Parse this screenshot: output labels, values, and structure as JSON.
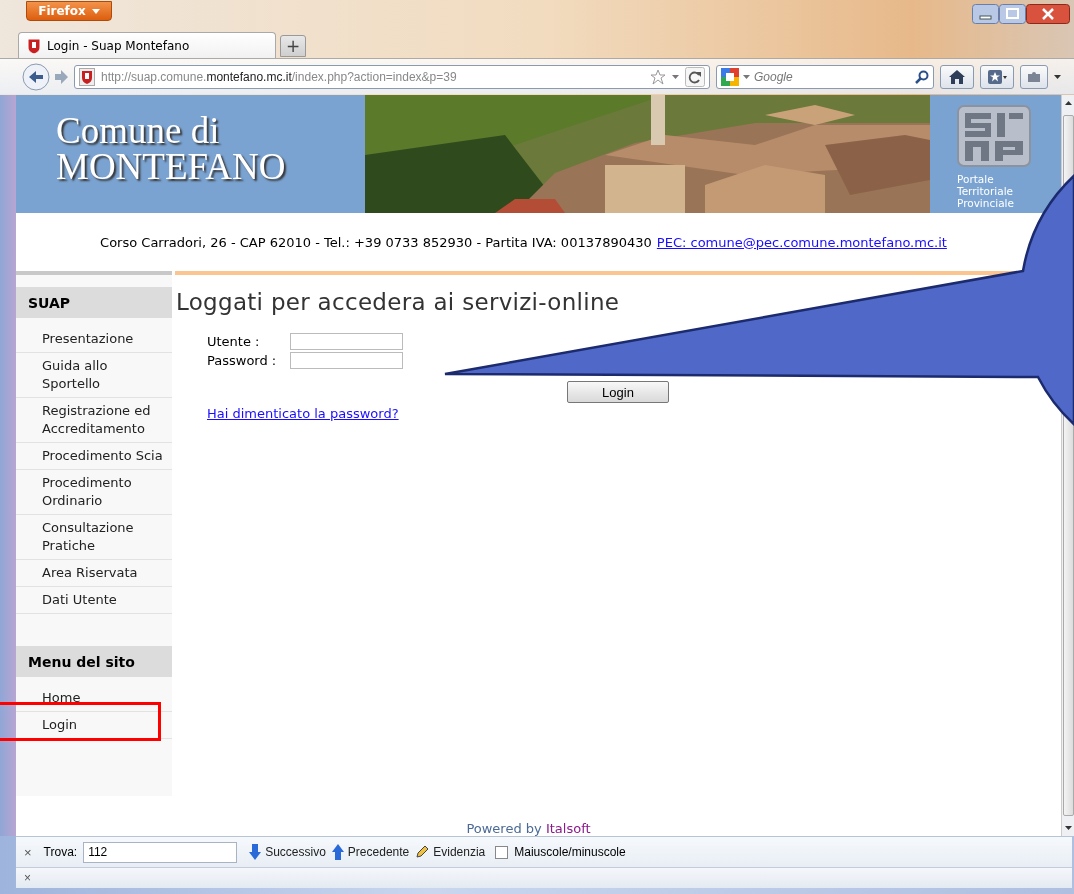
{
  "browser": {
    "menu_button": "Firefox",
    "tab": {
      "title": "Login - Suap Montefano"
    },
    "new_tab_button": "+",
    "url": {
      "prefix": "http://suap.comune.",
      "domain": "montefano.mc.it",
      "path": "/index.php?action=index&p=39"
    },
    "search": {
      "placeholder": "Google"
    }
  },
  "header": {
    "title_lines": [
      "Comune di",
      "MONTEFANO"
    ],
    "logo_caption": [
      "Portale",
      "Territoriale",
      "Provinciale"
    ]
  },
  "address": {
    "text": "Corso Carradori, 26 - CAP 62010 - Tel.: +39 0733 852930 - Partita IVA: 00137890430",
    "link": "PEC: comune@pec.comune.montefano.mc.it"
  },
  "sidebar": {
    "sections": [
      {
        "title": "SUAP",
        "items": [
          "Presentazione",
          "Guida allo Sportello",
          "Registrazione ed Accreditamento",
          "Procedimento Scia",
          "Procedimento Ordinario",
          "Consultazione Pratiche",
          "Area Riservata",
          "Dati Utente"
        ]
      },
      {
        "title": "Menu del sito",
        "items": [
          "Home",
          "Login"
        ]
      }
    ]
  },
  "main": {
    "heading": "Loggati per accedera ai servizi-online",
    "fields": [
      {
        "label": "Utente :"
      },
      {
        "label": "Password :"
      }
    ],
    "login_button": "Login",
    "forgot_link": "Hai dimenticato la password?"
  },
  "footer": {
    "prefix": "Powered by",
    "brand": "Italsoft"
  },
  "find_bar": {
    "close": "×",
    "label": "Trova:",
    "value": "112",
    "buttons": [
      {
        "label": "Successivo",
        "kind": "next"
      },
      {
        "label": "Precedente",
        "kind": "previous"
      },
      {
        "label": "Evidenzia",
        "kind": "highlight"
      }
    ],
    "match_case": {
      "label": "Maiuscole/minuscole",
      "checked": false
    }
  },
  "status_bar": {
    "close": "×"
  }
}
